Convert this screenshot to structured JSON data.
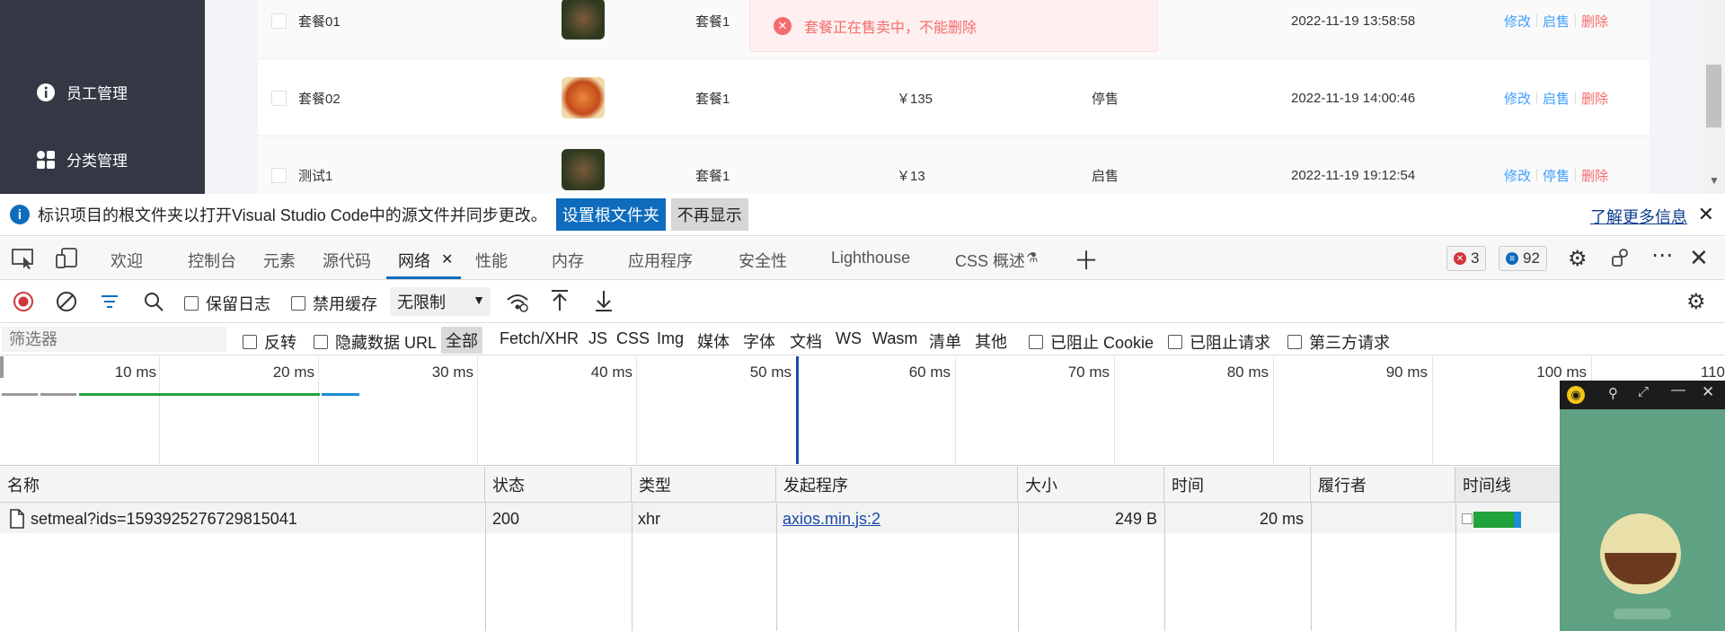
{
  "sidebar": {
    "items": [
      {
        "label": "员工管理",
        "icon": "info-icon"
      },
      {
        "label": "分类管理",
        "icon": "grid-icon"
      }
    ]
  },
  "table": {
    "rows": [
      {
        "name": "套餐01",
        "category": "套餐1",
        "price": "",
        "status": "",
        "updated": "2022-11-19 13:58:58",
        "actions": [
          "修改",
          "启售",
          "删除"
        ]
      },
      {
        "name": "套餐02",
        "category": "套餐1",
        "price": "￥135",
        "status": "停售",
        "updated": "2022-11-19 14:00:46",
        "actions": [
          "修改",
          "启售",
          "删除"
        ]
      },
      {
        "name": "测试1",
        "category": "套餐1",
        "price": "￥13",
        "status": "启售",
        "updated": "2022-11-19 19:12:54",
        "actions": [
          "修改",
          "停售",
          "删除"
        ]
      }
    ]
  },
  "toast": {
    "message": "套餐正在售卖中，不能删除"
  },
  "infobar": {
    "message": "标识项目的根文件夹以打开Visual Studio Code中的源文件并同步更改。",
    "primary_button": "设置根文件夹",
    "secondary_button": "不再显示",
    "learn_more": "了解更多信息"
  },
  "devtools": {
    "tabs": [
      "欢迎",
      "控制台",
      "元素",
      "源代码",
      "网络",
      "性能",
      "内存",
      "应用程序",
      "安全性",
      "Lighthouse",
      "CSS 概述"
    ],
    "active_tab": "网络",
    "errors": "3",
    "messages": "92"
  },
  "toolbar": {
    "preserve_log": "保留日志",
    "disable_cache": "禁用缓存",
    "throttle": "无限制"
  },
  "filterbar": {
    "placeholder": "筛选器",
    "invert": "反转",
    "hide_data_url": "隐藏数据 URL",
    "types": [
      "全部",
      "Fetch/XHR",
      "JS",
      "CSS",
      "Img",
      "媒体",
      "字体",
      "文档",
      "WS",
      "Wasm",
      "清单",
      "其他"
    ],
    "blocked_cookies": "已阻止 Cookie",
    "blocked_requests": "已阻止请求",
    "third_party": "第三方请求"
  },
  "timeline": {
    "ticks": [
      "10 ms",
      "20 ms",
      "30 ms",
      "40 ms",
      "50 ms",
      "60 ms",
      "70 ms",
      "80 ms",
      "90 ms",
      "100 ms",
      "110"
    ]
  },
  "grid": {
    "columns": [
      "名称",
      "状态",
      "类型",
      "发起程序",
      "大小",
      "时间",
      "履行者",
      "时间线"
    ],
    "requests": [
      {
        "name": "setmeal?ids=1593925276729815041",
        "status": "200",
        "type": "xhr",
        "initiator": "axios.min.js:2",
        "size": "249 B",
        "time": "20 ms",
        "fulfilled_by": ""
      }
    ]
  },
  "colors": {
    "sidebar_bg": "#343744",
    "link_blue": "#409eff",
    "danger_red": "#f56c6c",
    "devtools_accent": "#0f6cbd"
  }
}
